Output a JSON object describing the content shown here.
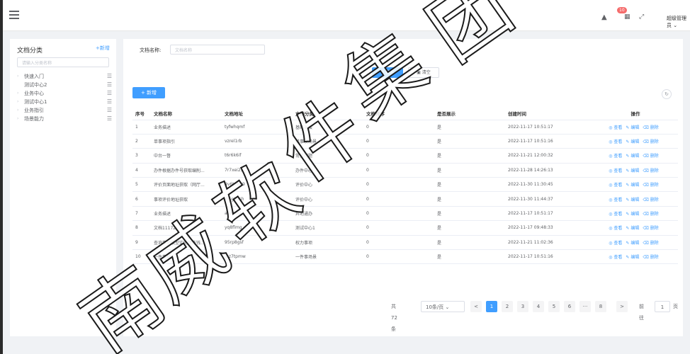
{
  "header": {
    "notification_count": "10",
    "user_name": "超级管理员"
  },
  "sidebar": {
    "title": "文档分类",
    "add_label": "+新增",
    "search_placeholder": "请输入分类名称",
    "items": [
      {
        "label": "快速入门",
        "expandable": true
      },
      {
        "label": "测试中心2",
        "expandable": false
      },
      {
        "label": "业务中心",
        "expandable": true
      },
      {
        "label": "测试中心1",
        "expandable": true
      },
      {
        "label": "业务指引",
        "expandable": true
      },
      {
        "label": "场景能力",
        "expandable": true
      }
    ]
  },
  "filter": {
    "label": "文档名称:",
    "placeholder": "文档名称",
    "search_label": "搜索",
    "clear_label": "清空"
  },
  "toolbar": {
    "add_label": "+ 新增"
  },
  "table": {
    "columns": [
      "序号",
      "文档名称",
      "文档地址",
      "文档分类",
      "文档排序",
      "是否展示",
      "创建时间",
      "操作"
    ],
    "rows": [
      [
        "1",
        "业务描述",
        "tyfwhqmf",
        "基础对接",
        "0",
        "是",
        "2022-11-17 10:51:17"
      ],
      [
        "2",
        "单事项指引",
        "vzrel1rb",
        "单事项场景",
        "0",
        "是",
        "2022-11-17 10:51:16"
      ],
      [
        "3",
        "中台一督",
        "t6r6k6if",
        "常见问题",
        "0",
        "是",
        "2022-11-21 12:00:32"
      ],
      [
        "4",
        "办件根据办件号获取编削...",
        "7r7xei23",
        "办件中心",
        "0",
        "是",
        "2022-11-28 14:26:13"
      ],
      [
        "5",
        "评价页面地址获取（网厅...",
        "9v6t6bh9",
        "评价中心",
        "0",
        "是",
        "2022-11-30 11:30:45"
      ],
      [
        "6",
        "事项评价地址获取",
        "ih5g2ash",
        "评价中心",
        "0",
        "是",
        "2022-11-30 11:44:37"
      ],
      [
        "7",
        "业务描述",
        "a6xpdsj",
        "异地通办",
        "0",
        "是",
        "2022-11-17 10:51:17"
      ],
      [
        "8",
        "文档11172",
        "yq8flmg",
        "测试中心1",
        "0",
        "是",
        "2022-11-17 09:48:33"
      ],
      [
        "9",
        "查询事项模型实例状态钱...",
        "95rp8gsf",
        "权力事项",
        "0",
        "是",
        "2022-11-21 11:02:36"
      ],
      [
        "10",
        "一件事指引",
        "mz7tpmw",
        "一件事场景",
        "0",
        "是",
        "2022-11-17 10:51:16"
      ]
    ],
    "ops": [
      "查看",
      "编辑",
      "删除"
    ]
  },
  "pager": {
    "total": "共 72 条",
    "page_size": "10条/页",
    "pages": [
      "1",
      "2",
      "3",
      "4",
      "5",
      "6",
      "···",
      "8"
    ],
    "current": "1",
    "goto_label": "前往",
    "goto_value": "1",
    "page_suffix": "页"
  },
  "watermark": {
    "text": "南威软件集团"
  }
}
